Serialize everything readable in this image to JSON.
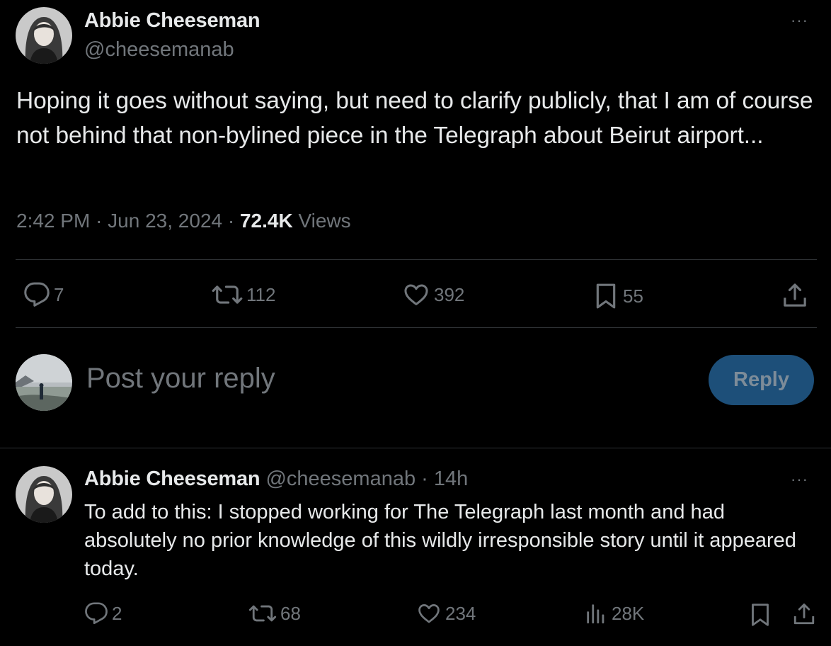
{
  "main_tweet": {
    "author_name": "Abbie Cheeseman",
    "author_handle": "@cheesemanab",
    "more_label": "···",
    "text": "Hoping it goes without saying, but need to clarify publicly, that I am of course not behind that non-bylined piece in the Telegraph about Beirut airport...",
    "time": "2:42 PM",
    "date": "Jun 23, 2024",
    "separator": "·",
    "views_count": "72.4K",
    "views_label": "Views",
    "replies": "7",
    "reposts": "112",
    "likes": "392",
    "bookmarks": "55"
  },
  "composer": {
    "placeholder": "Post your reply",
    "button_label": "Reply"
  },
  "reply_tweet": {
    "author_name": "Abbie Cheeseman",
    "author_handle": "@cheesemanab",
    "separator": "·",
    "age": "14h",
    "more_label": "···",
    "text": "To add to this: I stopped working for The Telegraph last month and had absolutely no prior knowledge of this wildly irresponsible story until it appeared today.",
    "replies": "2",
    "reposts": "68",
    "likes": "234",
    "views": "28K"
  },
  "icons": {
    "reply": "reply-bubble-icon",
    "repost": "repost-arrows-icon",
    "like": "heart-icon",
    "bookmark": "bookmark-icon",
    "share": "share-upload-icon",
    "views": "views-bars-icon",
    "more": "more-dots-icon"
  },
  "colors": {
    "background": "#000000",
    "text_primary": "#e7e9ea",
    "text_secondary": "#71767b",
    "divider": "#2f3336",
    "reply_button_bg": "#1d4f79"
  }
}
